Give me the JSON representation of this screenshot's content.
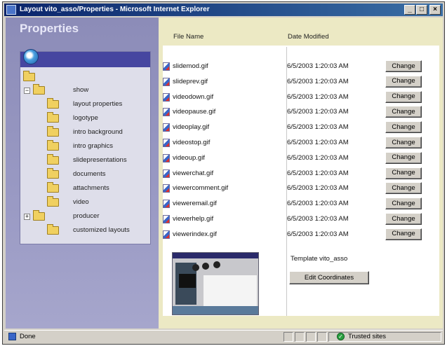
{
  "window": {
    "title": "Layout vito_asso/Properties - Microsoft Internet Explorer",
    "buttons": {
      "minimize": "_",
      "maximize": "□",
      "close": "×"
    }
  },
  "sidebar": {
    "heading": "Properties",
    "tree": [
      {
        "label": "show",
        "expander": "−"
      },
      {
        "label": "layout properties"
      },
      {
        "label": "logotype"
      },
      {
        "label": "intro background"
      },
      {
        "label": "intro graphics"
      },
      {
        "label": "slidepresentations"
      },
      {
        "label": "documents"
      },
      {
        "label": "attachments"
      },
      {
        "label": "video"
      },
      {
        "label": "producer",
        "expander": "+"
      },
      {
        "label": "customized layouts"
      }
    ]
  },
  "file_table": {
    "columns": {
      "name": "File Name",
      "date": "Date Modified"
    },
    "change_label": "Change",
    "rows": [
      {
        "name": "slidemod.gif",
        "date": "6/5/2003 1:20:03 AM"
      },
      {
        "name": "slideprev.gif",
        "date": "6/5/2003 1:20:03 AM"
      },
      {
        "name": "videodown.gif",
        "date": "6/5/2003 1:20:03 AM"
      },
      {
        "name": "videopause.gif",
        "date": "6/5/2003 1:20:03 AM"
      },
      {
        "name": "videoplay.gif",
        "date": "6/5/2003 1:20:03 AM"
      },
      {
        "name": "videostop.gif",
        "date": "6/5/2003 1:20:03 AM"
      },
      {
        "name": "videoup.gif",
        "date": "6/5/2003 1:20:03 AM"
      },
      {
        "name": "viewerchat.gif",
        "date": "6/5/2003 1:20:03 AM"
      },
      {
        "name": "viewercomment.gif",
        "date": "6/5/2003 1:20:03 AM"
      },
      {
        "name": "vieweremail.gif",
        "date": "6/5/2003 1:20:03 AM"
      },
      {
        "name": "viewerhelp.gif",
        "date": "6/5/2003 1:20:03 AM"
      },
      {
        "name": "viewerindex.gif",
        "date": "6/5/2003 1:20:03 AM"
      }
    ]
  },
  "template": {
    "name": "Template vito_asso",
    "edit_button": "Edit Coordinates"
  },
  "statusbar": {
    "status": "Done",
    "zone": "Trusted sites"
  },
  "colors": {
    "title_bar": "#0a246a",
    "sidebar": "#9a9ac4",
    "content_bg": "#ece9c4"
  }
}
